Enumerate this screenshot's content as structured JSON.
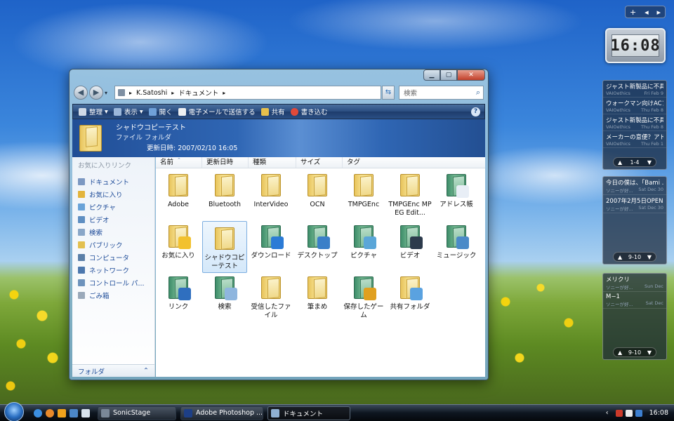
{
  "window": {
    "address": [
      "K.Satoshi",
      "ドキュメント"
    ],
    "search_placeholder": "検索",
    "toolbar": {
      "organize": "整理",
      "views": "表示",
      "open": "開く",
      "email": "電子メールで送信する",
      "share": "共有",
      "burn": "書き込む",
      "help": "?"
    },
    "details": {
      "title": "シャドウコピーテスト",
      "type": "ファイル フォルダ",
      "modified": "更新日時: 2007/02/10 16:05"
    },
    "left_pane": {
      "header": "お気に入りリンク",
      "links": [
        "ドキュメント",
        "お気に入り",
        "ピクチャ",
        "ビデオ",
        "検索",
        "パブリック",
        "コンピュータ",
        "ネットワーク",
        "コントロール パ...",
        "ごみ箱"
      ],
      "footer": "フォルダ"
    },
    "columns": [
      "名前",
      "更新日時",
      "種類",
      "サイズ",
      "タグ"
    ],
    "items": [
      {
        "label": "Adobe"
      },
      {
        "label": "Bluetooth"
      },
      {
        "label": "InterVideo"
      },
      {
        "label": "OCN"
      },
      {
        "label": "TMPGEnc"
      },
      {
        "label": "TMPGEnc MPEG Edit..."
      },
      {
        "label": "アドレス帳"
      },
      {
        "label": "お気に入り"
      },
      {
        "label": "シャドウコピーテスト"
      },
      {
        "label": "ダウンロード"
      },
      {
        "label": "デスクトップ"
      },
      {
        "label": "ピクチャ"
      },
      {
        "label": "ビデオ"
      },
      {
        "label": "ミュージック"
      },
      {
        "label": "リンク"
      },
      {
        "label": "検索"
      },
      {
        "label": "受信したファイル"
      },
      {
        "label": "筆まめ"
      },
      {
        "label": "保存したゲーム"
      },
      {
        "label": "共有フォルダ"
      }
    ]
  },
  "gadgets": {
    "sidebar_controls": {
      "add": "+",
      "prev": "◂",
      "next": "▸"
    },
    "clock": "16:08",
    "feed1": {
      "items": [
        {
          "title": "ジャスト新製品に不具...",
          "source": "VAIOethics",
          "date": "Fri Feb 9"
        },
        {
          "title": "ウォークマン向けACア...",
          "source": "VAIOethics",
          "date": "Thu Feb 8"
        },
        {
          "title": "ジャスト新製品に不具...",
          "source": "VAIOethics",
          "date": "Thu Feb 8"
        },
        {
          "title": "メーカーの意便？アド...",
          "source": "VAIOethics",
          "date": "Thu Feb 1"
        }
      ],
      "pager": "1-4"
    },
    "feed2": {
      "items": [
        {
          "title": "今日の僕は、「Bami ...",
          "source": "ソニーが好...",
          "date": "Sat Dec 30"
        },
        {
          "title": "2007年2月5日OPEN...",
          "source": "ソニーが好...",
          "date": "Sat Dec 30"
        }
      ],
      "pager": "9-10"
    },
    "feed3": {
      "items": [
        {
          "title": "メリクリ",
          "source": "ソニーが好...",
          "date": "Sun Dec"
        },
        {
          "title": "M−1",
          "source": "ソニーが好...",
          "date": "Sat Dec"
        }
      ],
      "pager": "9-10"
    }
  },
  "taskbar": {
    "tasks": [
      "SonicStage",
      "Adobe Photoshop ...",
      "ドキュメント"
    ],
    "time": "16:08"
  }
}
